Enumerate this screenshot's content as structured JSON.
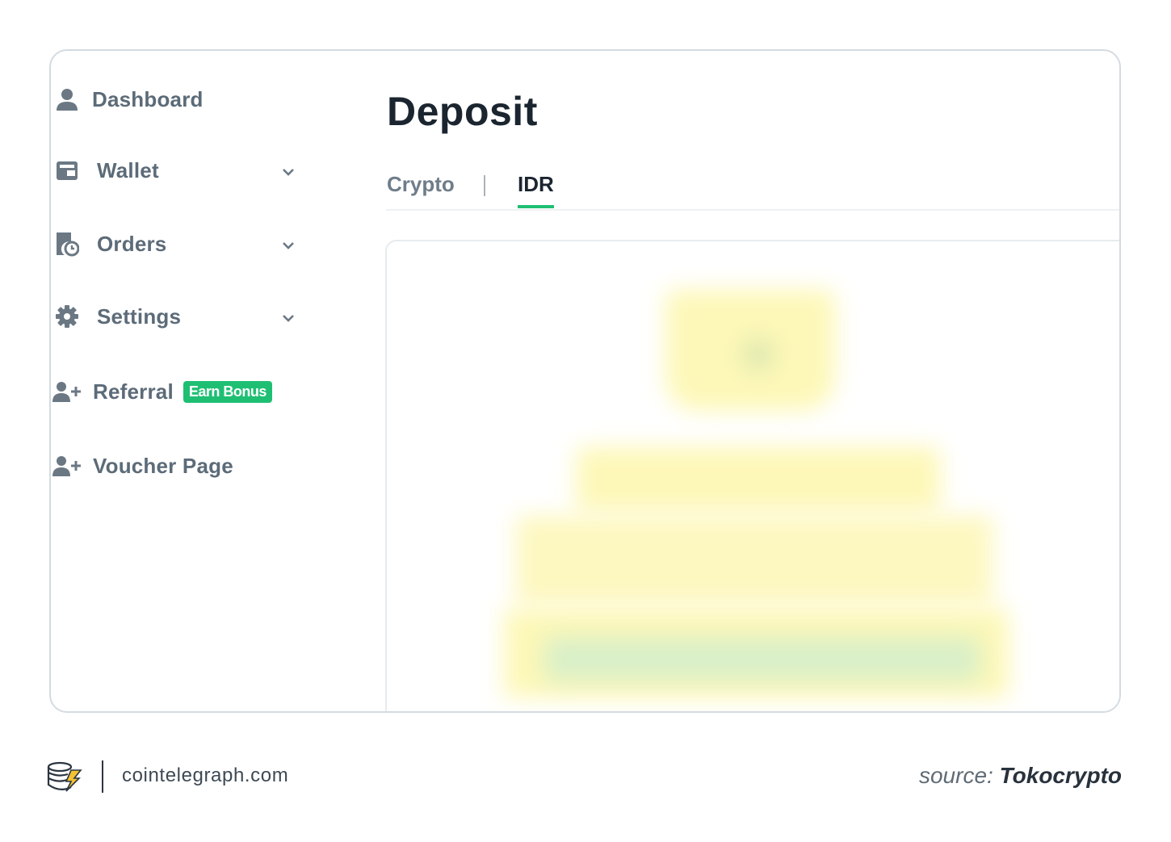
{
  "sidebar": {
    "items": [
      {
        "label": "Dashboard",
        "icon": "user-icon"
      },
      {
        "label": "Wallet",
        "icon": "wallet-icon",
        "has_chevron": true
      },
      {
        "label": "Orders",
        "icon": "orders-icon",
        "has_chevron": true
      },
      {
        "label": "Settings",
        "icon": "gear-icon",
        "has_chevron": true
      },
      {
        "label": "Referral",
        "icon": "user-plus-icon",
        "badge": "Earn Bonus"
      },
      {
        "label": "Voucher Page",
        "icon": "user-plus-icon"
      }
    ]
  },
  "main": {
    "title": "Deposit",
    "tabs": [
      {
        "label": "Crypto",
        "active": false
      },
      {
        "label": "IDR",
        "active": true
      }
    ]
  },
  "footer": {
    "site": "cointelegraph.com",
    "source_prefix": "source:",
    "source_name": "Tokocrypto"
  },
  "colors": {
    "accent": "#1fbf73",
    "text_muted": "#5c6b78",
    "frame_border": "#d4dbe1"
  }
}
